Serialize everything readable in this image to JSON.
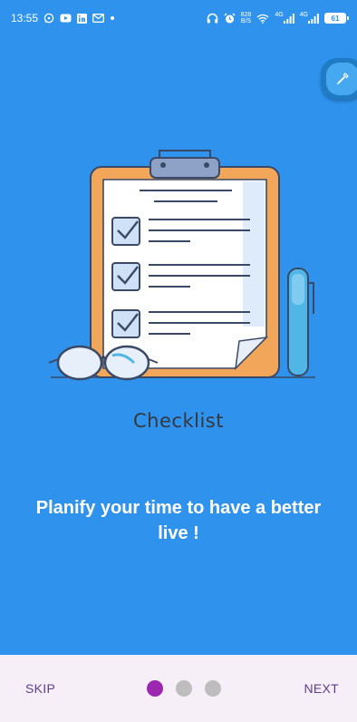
{
  "status_bar": {
    "time": "13:55",
    "data_speed_value": "828",
    "data_speed_unit": "B/S",
    "network_1": "4G",
    "network_2": "4G",
    "battery_level": "61"
  },
  "slide": {
    "illustration_label": "Checklist",
    "headline": "Planify your time to have a better live !"
  },
  "navigation": {
    "skip_label": "SKIP",
    "next_label": "NEXT",
    "page_count": 3,
    "active_page": 1
  },
  "colors": {
    "background": "#2F93EE",
    "bottom_bar": "#F7EFF7",
    "active_dot": "#9C27B0",
    "inactive_dot": "#BDBDBD",
    "nav_text": "#5E3D8F"
  },
  "icons": {
    "status_left": [
      "whatsapp-icon",
      "youtube-icon",
      "linkedin-icon",
      "gmail-icon",
      "notification-dot-icon"
    ],
    "status_right": [
      "headphones-icon",
      "alarm-icon",
      "wifi-icon",
      "signal-icon",
      "signal-icon",
      "battery-icon"
    ],
    "fab": "color-picker-icon"
  }
}
